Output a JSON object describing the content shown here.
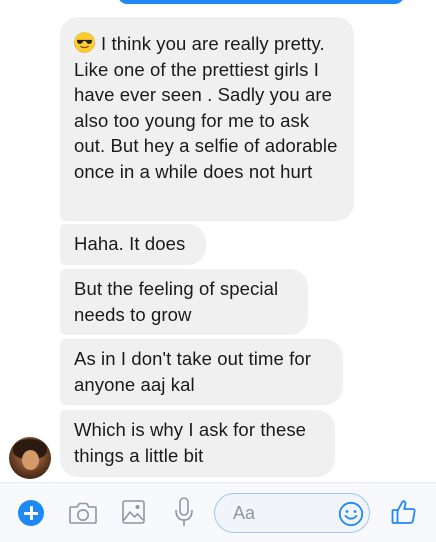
{
  "messages": [
    {
      "text": "I think you are really pretty. Like one of the prettiest girls I have ever seen . Sadly you are also too young for me to ask out. But hey a selfie of adorable once in a while does not hurt",
      "emoji": "smiling-face-with-sunglasses"
    },
    {
      "text": "Haha. It does"
    },
    {
      "text": "But the feeling of special needs to grow"
    },
    {
      "text": "As in I don't take out time for anyone aaj kal"
    },
    {
      "text": "Which is why I ask for these things a little bit"
    }
  ],
  "composer": {
    "placeholder": "Aa",
    "icons": [
      "plus-icon",
      "camera-icon",
      "image-icon",
      "microphone-icon",
      "emoji-icon",
      "thumbs-up-icon"
    ],
    "accent_color": "#1E88F5"
  },
  "colors": {
    "bubble_background": "#F0F0F0",
    "text": "#1A1A1A",
    "brand_blue": "#1E88F5"
  }
}
